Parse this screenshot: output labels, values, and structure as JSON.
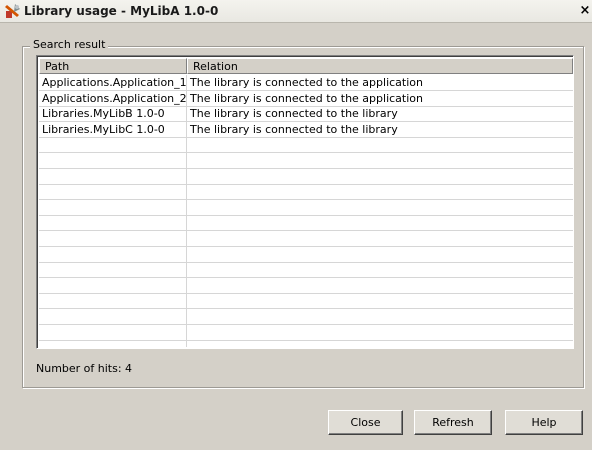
{
  "window": {
    "title": "Library usage - MyLibA 1.0-0",
    "close_glyph": "×"
  },
  "search_result": {
    "legend": "Search result",
    "columns": {
      "path": "Path",
      "relation": "Relation"
    },
    "rows": [
      {
        "path": "Applications.Application_1",
        "relation": "The library is connected to the application"
      },
      {
        "path": "Applications.Application_2",
        "relation": "The library is connected to the application"
      },
      {
        "path": "Libraries.MyLibB 1.0-0",
        "relation": "The library is connected to the library"
      },
      {
        "path": "Libraries.MyLibC 1.0-0",
        "relation": "The library is connected to the library"
      }
    ],
    "hits_text": "Number of hits: 4"
  },
  "buttons": {
    "close": "Close",
    "refresh": "Refresh",
    "help": "Help"
  }
}
